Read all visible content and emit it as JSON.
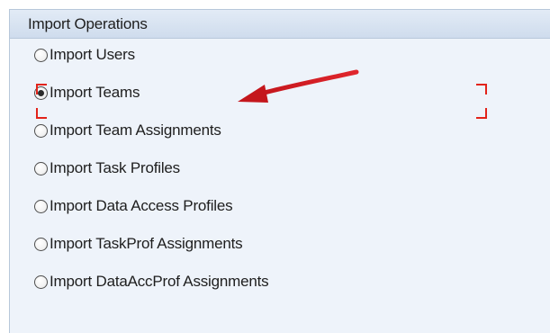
{
  "panel": {
    "title": "Import Operations"
  },
  "options": [
    {
      "label": "Import Users",
      "selected": false
    },
    {
      "label": "Import Teams",
      "selected": true
    },
    {
      "label": "Import Team Assignments",
      "selected": false
    },
    {
      "label": "Import Task Profiles",
      "selected": false
    },
    {
      "label": "Import Data Access Profiles",
      "selected": false
    },
    {
      "label": "Import TaskProf Assignments",
      "selected": false
    },
    {
      "label": "Import DataAccProf Assignments",
      "selected": false
    }
  ],
  "colors": {
    "annotation": "#e2231a",
    "panel_background": "#eef3fa",
    "header_background": "#d8e4f1",
    "border": "#b7c7da"
  },
  "icons": {
    "radio": "radio-button-icon",
    "annotation_arrow": "arrow-icon"
  }
}
